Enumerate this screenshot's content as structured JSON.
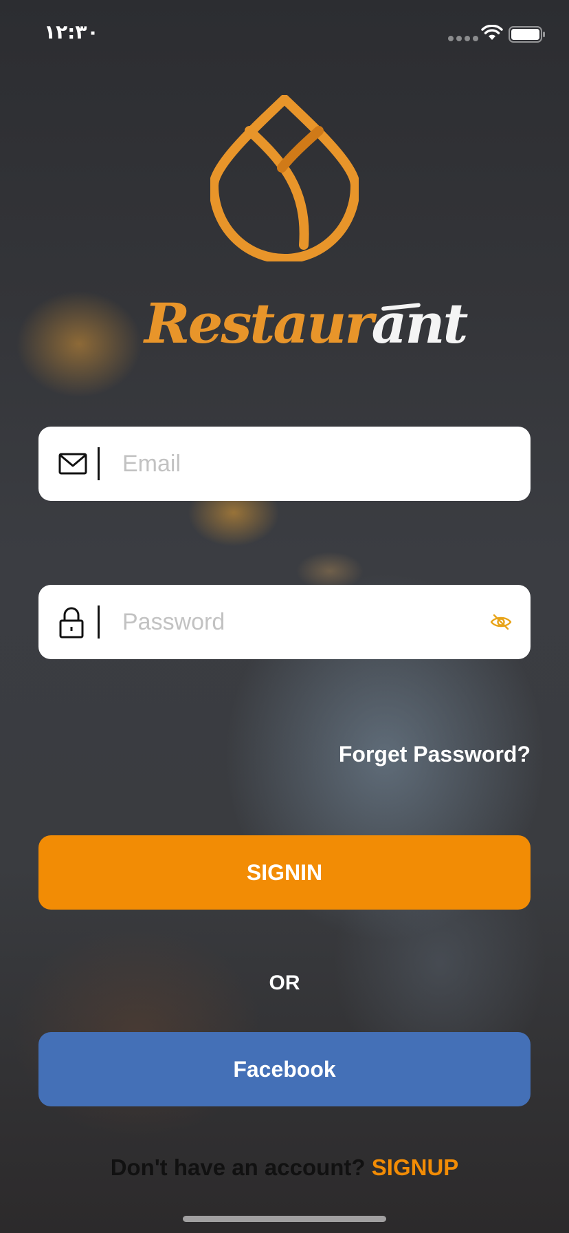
{
  "status_bar": {
    "time": "۱۲:۳۰",
    "signal_icon": "signal-dots-icon",
    "wifi_icon": "wifi-icon",
    "battery_icon": "battery-icon"
  },
  "logo": {
    "mark_icon": "tulip-logo-icon",
    "word_part_a": "Restaur",
    "word_part_b": "ant",
    "accent_color": "#e8952a"
  },
  "login_form": {
    "email": {
      "icon": "mail-icon",
      "placeholder": "Email",
      "value": ""
    },
    "password": {
      "icon": "lock-icon",
      "placeholder": "Password",
      "value": "",
      "toggle_icon": "eye-off-icon"
    },
    "forgot_password_label": "Forget Password?",
    "signin_label": "SIGNIN",
    "or_label": "OR",
    "facebook_label": "Facebook"
  },
  "footer": {
    "prompt": "Don't have an account?",
    "signup_label": "SIGNUP"
  },
  "colors": {
    "primary": "#f28c05",
    "facebook": "#4470b7",
    "input_background": "#ffffff",
    "placeholder": "#c2c2c2"
  }
}
